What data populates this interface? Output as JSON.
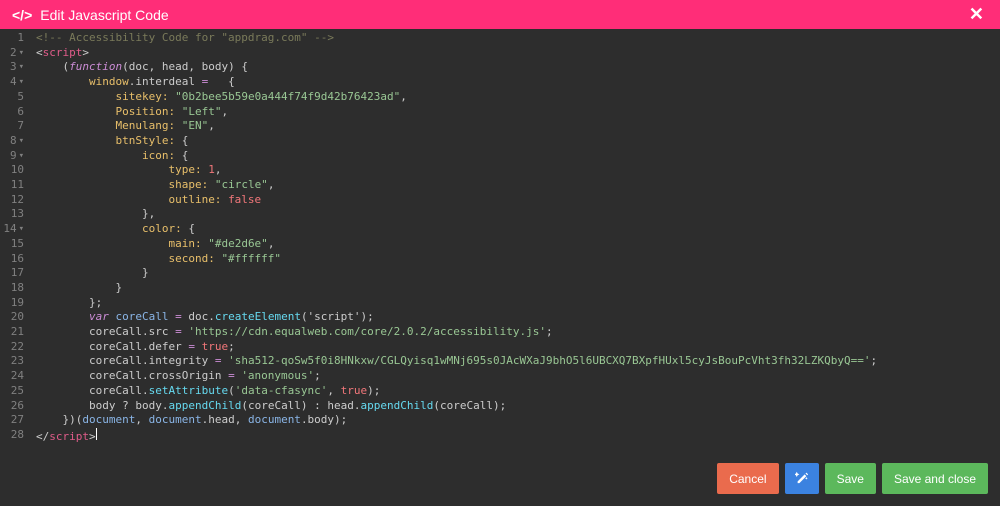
{
  "header": {
    "title": "Edit Javascript Code"
  },
  "footer": {
    "cancel": "Cancel",
    "save": "Save",
    "save_close": "Save and close"
  },
  "gutter": {
    "lines": [
      "1",
      "2",
      "3",
      "4",
      "5",
      "6",
      "7",
      "8",
      "9",
      "10",
      "11",
      "12",
      "13",
      "14",
      "15",
      "16",
      "17",
      "18",
      "19",
      "20",
      "21",
      "22",
      "23",
      "24",
      "25",
      "26",
      "27",
      "28"
    ],
    "fold_lines": [
      2,
      3,
      4,
      8,
      9,
      14
    ]
  },
  "code": {
    "l1_comment": "<!-- Accessibility Code for \"appdrag.com\" -->",
    "l2_tag_open": "script",
    "l3_func": "function",
    "l3_args": "(doc, head, body) {",
    "l4_window": "window",
    "l4_interdeal": ".interdeal",
    "l4_eq": " = ",
    "l4_brace": "  {",
    "l5_key": "sitekey:",
    "l5_val": "\"0b2bee5b59e0a444f74f9d42b76423ad\"",
    "l6_key": "Position:",
    "l6_val": "\"Left\"",
    "l7_key": "Menulang:",
    "l7_val": "\"EN\"",
    "l8_key": "btnStyle:",
    "l9_key": "icon:",
    "l10_key": "type:",
    "l10_val": "1",
    "l11_key": "shape:",
    "l11_val": "\"circle\"",
    "l12_key": "outline:",
    "l12_val": "false",
    "l14_key": "color:",
    "l15_key": "main:",
    "l15_val": "\"#de2d6e\"",
    "l16_key": "second:",
    "l16_val": "\"#ffffff\"",
    "l20_var": "var",
    "l20_core": "coreCall",
    "l20_eq": " = ",
    "l20_doc": "doc.",
    "l20_create": "createElement",
    "l20_arg": "('script');",
    "l21_lhs": "coreCall.src",
    "l21_val": "'https://cdn.equalweb.com/core/2.0.2/accessibility.js'",
    "l22_lhs": "coreCall.defer",
    "l22_val": "true",
    "l23_lhs": "coreCall.integrity",
    "l23_val": "'sha512-qoSw5f0i8HNkxw/CGLQyisq1wMNj695s0JAcWXaJ9bhO5l6UBCXQ7BXpfHUxl5cyJsBouPcVht3fh32LZKQbyQ=='",
    "l24_lhs": "coreCall.crossOrigin",
    "l24_val": "'anonymous'",
    "l25_call": "coreCall.",
    "l25_set": "setAttribute",
    "l25_arg1": "'data-cfasync'",
    "l25_arg2": "true",
    "l26_body": "body ? body.",
    "l26_app": "appendChild",
    "l26_mid": "(coreCall) : head.",
    "l26_end": "(coreCall);",
    "l27_doc1": "document",
    "l27_doc2": "document",
    "l27_head": ".head, ",
    "l27_doc3": "document",
    "l27_body": ".body);",
    "l28_tag_close": "script"
  }
}
